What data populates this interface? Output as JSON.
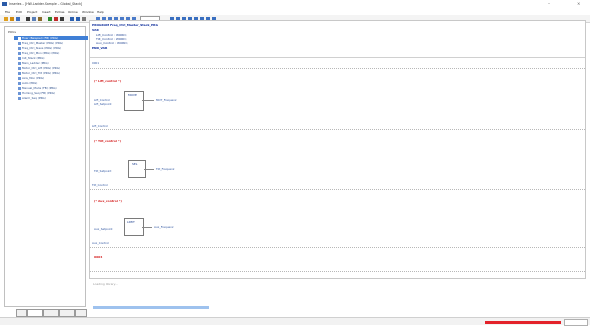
{
  "window": {
    "title": "Inseries – [HW-Ladder-Sample – Global_Stack]",
    "minimize": "–",
    "close": "×"
  },
  "menu": [
    "File",
    "Edit",
    "Project",
    "Insert",
    "Extras",
    "Online",
    "Window",
    "Help"
  ],
  "sidebar": {
    "root": "POUs",
    "items": [
      "Fixer (Beispiel) (FB) (PRG)",
      "Freq_Ctrl_Master (PRG) (PRG)",
      "Freq_Ctrl_Slave (PRG) (PRG)",
      "Freq_Ctrl_Mon (PRG) (PRG)",
      "Init_Stack (PRG)",
      "Main_Ladder (PRG)",
      "Motor_Ctrl_Lift (PRG) (PRG)",
      "Motor_Ctrl_Tilt (PRG) (PRG)",
      "Axis_Mon (PRG)",
      "Auto (PRG)",
      "Manual_Mode (FB) (PRG)",
      "Homing_Seq (FB) (PRG)",
      "Alarm_Seq (PRG)"
    ]
  },
  "editor": {
    "decl": [
      "PROGRAM Freq_Ctrl_Master_Stack_PRG",
      "VAR",
      "  Lift_Control : WORD;",
      "  Tilt_Control : WORD;",
      "  Aux_Control : WORD;",
      "END_VAR"
    ],
    "networks": [
      {
        "num": "0001",
        "label": "Lift_Control",
        "comment": "(* Lift_control *)"
      },
      {
        "num": "0002",
        "label": "Tilt_Control",
        "comment": "(* Tilt_control *)"
      },
      {
        "num": "0003",
        "label": "Aux_Control",
        "comment": "(* Aux_control *)"
      },
      {
        "num": "0004",
        "label": "",
        "comment": ""
      }
    ],
    "blocks": [
      {
        "name": "MOVE",
        "in1": "Lift_Control",
        "in2": "Lift_Setpoint",
        "out": "MOT_Frequenz"
      },
      {
        "name": "SEL",
        "in1": "Tilt_Setpoint",
        "out": "Tilt_Frequenz"
      },
      {
        "name": "LIMIT",
        "in1": "Aux_Setpoint",
        "out": "Aux_Frequenz"
      }
    ]
  },
  "output": {
    "text": "Loading library..."
  },
  "status": {
    "progress": 1.0
  },
  "colors": {
    "selection": "#3f7fd6",
    "accent_red": "#e3222a",
    "keyword": "#0a2a9a"
  }
}
